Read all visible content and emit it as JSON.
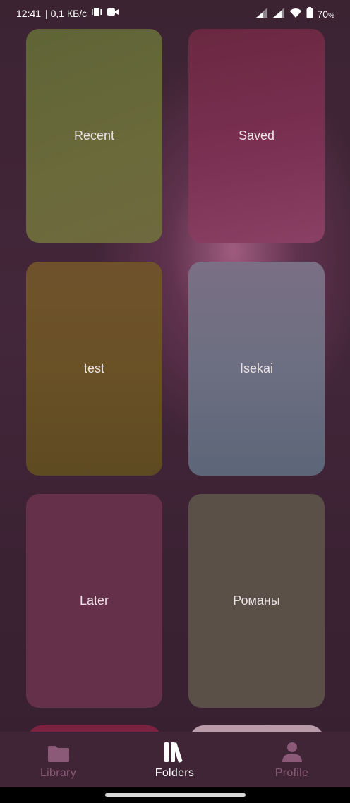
{
  "status_bar": {
    "time": "12:41",
    "network_speed": "| 0,1 КБ/с",
    "battery": "70",
    "battery_unit": "%",
    "icons": [
      "vibrate-icon",
      "video-camera-icon",
      "signal-icon",
      "signal-icon",
      "wifi-icon",
      "battery-icon"
    ]
  },
  "folders": [
    {
      "label": "Recent",
      "color": "#6a6a3a"
    },
    {
      "label": "Saved",
      "color": "#7a2f52"
    },
    {
      "label": "test",
      "color": "#6b5126"
    },
    {
      "label": "Isekai",
      "color": "#6c7082"
    },
    {
      "label": "Later",
      "color": "#66304a"
    },
    {
      "label": "Романы",
      "color": "#5c5048"
    }
  ],
  "bottom_nav": {
    "items": [
      {
        "label": "Library",
        "icon": "folder-icon",
        "active": false
      },
      {
        "label": "Folders",
        "icon": "books-icon",
        "active": true
      },
      {
        "label": "Profile",
        "icon": "person-icon",
        "active": false
      }
    ],
    "active_color": "#ffffff",
    "inactive_color": "#8a5a78"
  }
}
